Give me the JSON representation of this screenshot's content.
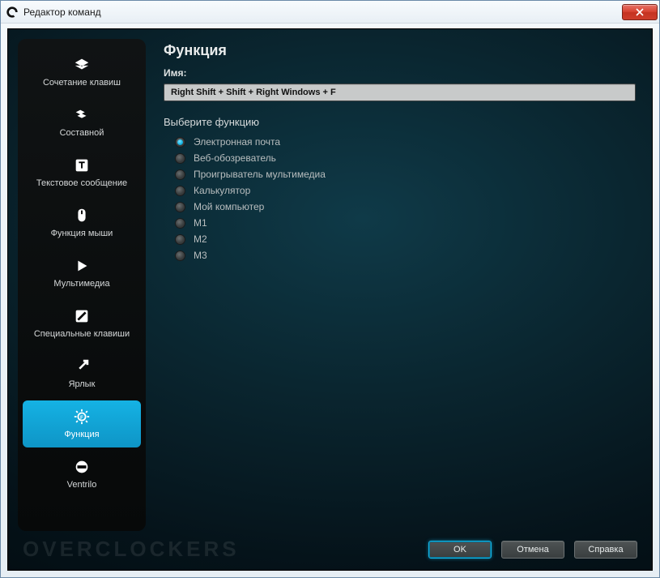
{
  "window": {
    "title": "Редактор команд"
  },
  "sidebar": {
    "items": [
      {
        "id": "keystroke",
        "label": "Сочетание клавиш"
      },
      {
        "id": "multikey",
        "label": "Составной"
      },
      {
        "id": "textblock",
        "label": "Текстовое сообщение"
      },
      {
        "id": "mousefn",
        "label": "Функция мыши"
      },
      {
        "id": "media",
        "label": "Мультимедиа"
      },
      {
        "id": "hotkeys",
        "label": "Специальные клавиши"
      },
      {
        "id": "shortcut",
        "label": "Ярлык"
      },
      {
        "id": "function",
        "label": "Функция"
      },
      {
        "id": "ventrilo",
        "label": "Ventrilo"
      }
    ],
    "selected_id": "function"
  },
  "panel": {
    "heading": "Функция",
    "name_label": "Имя:",
    "name_value": "Right Shift + Shift + Right Windows + F",
    "choose_label": "Выберите функцию",
    "radios": [
      {
        "label": "Электронная почта",
        "checked": true
      },
      {
        "label": "Веб-обозреватель",
        "checked": false
      },
      {
        "label": "Проигрыватель мультимедиа",
        "checked": false
      },
      {
        "label": "Калькулятор",
        "checked": false
      },
      {
        "label": "Мой компьютер",
        "checked": false
      },
      {
        "label": "M1",
        "checked": false
      },
      {
        "label": "M2",
        "checked": false
      },
      {
        "label": "M3",
        "checked": false
      }
    ]
  },
  "footer": {
    "ok": "OK",
    "cancel": "Отмена",
    "help": "Справка"
  },
  "watermark": "OVERCLOCKERS"
}
